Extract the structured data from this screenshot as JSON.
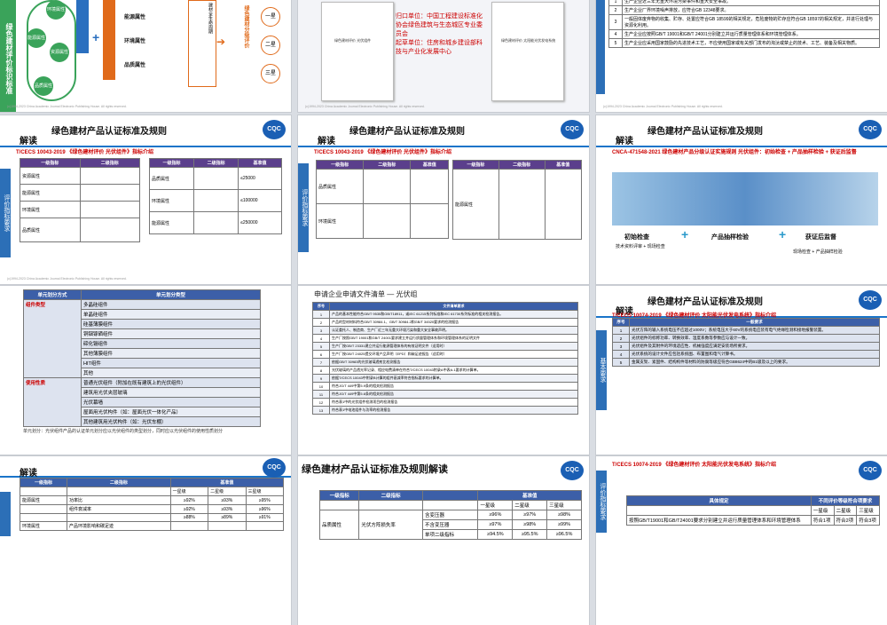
{
  "s0": {
    "sidebar": "绿色建材评价标识标准",
    "bubbles": [
      "环境属性",
      "能源属性",
      "资源属性",
      "品质属性"
    ],
    "mid_labels": [
      "能源属性",
      "环境属性",
      "品质属性"
    ],
    "vertical_text": "建材全生命周期",
    "arrow_text": "绿色建材分级评价",
    "levels": [
      "一星",
      "二星",
      "三星"
    ],
    "footer": "(c)1994-2023 China Academic Journal Electronic Publishing House. All rights reserved."
  },
  "s1": {
    "lines": [
      "归口单位：中国工程建设标准化协会绿色建筑与生态城区专业委员会",
      "起草单位：住房和城乡建设部科技与产业化发展中心"
    ],
    "doc_title_left": "绿色建材评价 光伏组件",
    "doc_title_right": "绿色建材评价 太阳能光伏发电系统",
    "footer": "(c)1994-2023 China Academic Journal Electronic Publishing House. All rights reserved."
  },
  "s2": {
    "rows": [
      {
        "n": "1",
        "t": "生产企业近三年无重大环境污染事件和重大安全事故。"
      },
      {
        "n": "2",
        "t": "生产企业厂界环境噪声排放，应符合GB 12348要求。"
      },
      {
        "n": "3",
        "t": "一般固体废弃物的收集、贮存、处置应符合GB 18599的相关规定，危险废物的贮存应符合GB 18597的相关规定，并进行处理与资源化利用。"
      },
      {
        "n": "4",
        "t": "生产企业应按照GB/T 19001和GB/T 24001分别建立并运行质量管理体系和环境管理体系。"
      },
      {
        "n": "5",
        "t": "生产企业应采用国家鼓励的先进技术工艺，不应使用国家或有关部门发布的淘汰或禁止的技术、工艺、装备及相关物质。"
      }
    ],
    "footer": "(c)1994-2023 China Academic Journal Electronic Publishing House. All rights reserved."
  },
  "s3": {
    "title": "绿色建材产品认证标准及规则",
    "sub": "解读",
    "std": "T/CECS 10043-2019 《绿色建材评价 光伏组件》指标介绍",
    "bar": "评价指标要求",
    "left_head": [
      "一级指标",
      "二级指标"
    ],
    "right_head": [
      "一级指标",
      "二级指标",
      "基准值"
    ],
    "left_rows": [
      "资源属性",
      "能源属性",
      "环境属性",
      "品质属性"
    ],
    "right_rows": [
      "品质属性",
      "环境属性",
      "能源属性"
    ],
    "vals": [
      "≤25000",
      "≤100000",
      "≤250000"
    ],
    "footer": "(c)1994-2023 China Academic Journal Electronic Publishing House. All rights reserved."
  },
  "s4": {
    "title": "绿色建材产品认证标准及规则",
    "sub": "解读",
    "std": "T/CECS 10043-2019 《绿色建材评价 光伏组件》指标介绍",
    "bar": "评价指标要求",
    "col_head": [
      "一级指标",
      "二级指标",
      "基准值"
    ],
    "rows": [
      "品质属性",
      "环境属性",
      "能源属性"
    ],
    "footer": "(c)1994-2023 China Academic Journal Electronic Publishing House. All rights reserved."
  },
  "s5": {
    "title": "绿色建材产品认证标准及规则",
    "sub": "解读",
    "std": "CNCA-471548-2021 绿色建材产品分级认证实施规则 光伏组件：初始检查 + 产品抽样检验 + 获证后监督",
    "steps": [
      "初始检查",
      "产品抽样检验",
      "获证后监督"
    ],
    "step_sub": [
      "技术资料评审 + 现场检查",
      "",
      "现场检查 + 产品抽样检验"
    ],
    "plus": "+"
  },
  "s6": {
    "head": [
      "单元划分方式",
      "单元划分类型"
    ],
    "group1": "组件类型",
    "items1": [
      "多晶硅组件",
      "单晶硅组件",
      "硅基薄膜组件",
      "铜铟镓硒组件",
      "碲化镉组件",
      "其他薄膜组件",
      "HIT组件",
      "其他"
    ],
    "group2": "使用性质",
    "items2": [
      "普通光伏组件（附加在既有建筑上的光伏组件）",
      "建筑用光伏夹层玻璃",
      "光伏幕墙",
      "屋面用光伏构件（如：屋面光伏一体化产品）",
      "其他建筑用光伏构件（如：光伏车棚）"
    ],
    "note": "单元划分：光伏组件产品的认证单元划分应以光伏组件的类型划分，同时应以光伏组件的使用性质划分"
  },
  "s7": {
    "title": "申请企业申请文件清单 — 光伏组",
    "head": [
      "序号",
      "文件清单要求"
    ],
    "rows": [
      {
        "n": "1",
        "t": "产品的基本性能符合GB/T 9535和GB/T18911，或IEC 61215系列标准和IEC 61730系列标准的相关检测报告。"
      },
      {
        "n": "2",
        "t": "产品的型材材料符合GB/T 30984.1、GB/T 30984.2和GB/T 34520要求的检测报告"
      },
      {
        "n": "3",
        "t": "认证委托人、制造商、生产厂近三年无重大环境污染和重大安全事故声明。"
      },
      {
        "n": "4",
        "t": "生产厂按照GB/T 19001和GB/T 24001要求建立并运行质量管理体系和环境管理体系的证明文件"
      },
      {
        "n": "5",
        "t": "生产厂按GB/T 23331建立并运行能源管理体系的有效证明文件（适用时）"
      },
      {
        "n": "6",
        "t": "生产厂按GB/T 24025提交环境产品声明（EPD）和碳足迹报告（适用时）"
      },
      {
        "n": "7",
        "t": "依据GB/T 30983的光伏玻璃透射比检测报告"
      },
      {
        "n": "8",
        "t": "光伏玻璃的产品透光率记录、相应电费清单在符合T/CECS 10043附录A中表A.1要求的计算单。"
      },
      {
        "n": "9",
        "t": "依据T/CECS 10043中附录B计算的组件衰减率符合指标要求的计算单。"
      },
      {
        "n": "10",
        "t": "符合JG/T 449中第5.9条的相关检测报告"
      },
      {
        "n": "11",
        "t": "符合JG/T 449中第5.6条的相关检测报告"
      },
      {
        "n": "12",
        "t": "符合表1中的光伏组件检测项目的检测报告"
      },
      {
        "n": "13",
        "t": "符合表1中电池组件与功率的检测报告"
      }
    ]
  },
  "s8": {
    "title": "绿色建材产品认证标准及规则",
    "sub": "解读",
    "std": "T/CECS 10074-2019 《绿色建材评价 太阳能光伏发电系统》指标介绍",
    "bar": "基本要求",
    "head": [
      "序号",
      "一般要求"
    ],
    "rows": [
      {
        "n": "1",
        "t": "光伏方阵的输入系统电压不应超过1000V；系统电压大于60V的系统电应装有电气绝缘检测和接地报警装置。"
      },
      {
        "n": "2",
        "t": "光伏组件的标称功率、转换效率、温度系数等参数应与设计一致。"
      },
      {
        "n": "3",
        "t": "光伏组件及其附件的环境适应性、机械强度应满足安装场所要求。"
      },
      {
        "n": "4",
        "t": "光伏系统的设计文件应包括系统图、布置图和电气计算书。"
      },
      {
        "n": "5",
        "t": "金属支架、紧固件、结构构件等材料的防腐等级应符合GB8624中的B1级及以上的要求。"
      }
    ]
  },
  "s9": {
    "sub": "解读",
    "head": [
      "一级指标",
      "二级指标",
      "基准值"
    ],
    "levels": [
      "一星级",
      "二星级",
      "三星级"
    ],
    "rows": [
      {
        "a": "能源属性",
        "b": "功率比",
        "v": [
          "≥92%",
          "≥93%",
          "≥95%"
        ]
      },
      {
        "a": "",
        "b": "组件衰减率",
        "v": [
          "≥92%",
          "≥93%",
          "≥96%"
        ]
      },
      {
        "a": "",
        "b": "",
        "v": [
          "≥88%",
          "≥89%",
          "≥91%"
        ]
      },
      {
        "a": "环境属性",
        "b": "产品环境影响和碳足迹",
        "v": [
          "",
          "",
          ""
        ]
      }
    ]
  },
  "s10": {
    "title": "绿色建材产品认证标准及规则解读",
    "head": [
      "一级指标",
      "二级指标",
      "基准值"
    ],
    "levels": [
      "一星级",
      "二星级",
      "三星级"
    ],
    "row_a": "品质属性",
    "row_b": "光伏方阵损失率",
    "cells": [
      {
        "c": "含变压器",
        "v": [
          "≥96%",
          "≥97%",
          "≥98%"
        ]
      },
      {
        "c": "不含变压器",
        "v": [
          "≥97%",
          "≥98%",
          "≥99%"
        ]
      },
      {
        "c": "单项二级指标",
        "v": [
          "≥94.5%",
          "≥95.5%",
          "≥96.5%"
        ]
      }
    ]
  },
  "s11": {
    "std": "T/CECS 10074-2019 《绿色建材评价 太阳能光伏发电系统》指标介绍",
    "bar": "评价指标要求",
    "head": [
      "具体规定",
      "不同评价等级符合项要求"
    ],
    "levels": [
      "一星级",
      "二星级",
      "三星级"
    ],
    "row": "按照GB/T19001和GB/T24001要求分别建立并运行质量管理体系和环境管理体系",
    "vals": [
      "符合1项",
      "符合2项",
      "符合3项"
    ]
  }
}
